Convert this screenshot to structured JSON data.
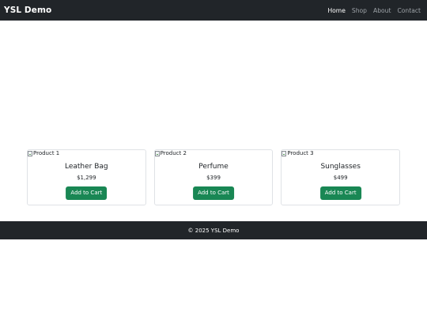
{
  "navbar": {
    "brand": "YSL Demo",
    "links": [
      {
        "label": "Home",
        "active": true
      },
      {
        "label": "Shop",
        "active": false
      },
      {
        "label": "About",
        "active": false
      },
      {
        "label": "Contact",
        "active": false
      }
    ]
  },
  "products": [
    {
      "image_alt": "Product 1",
      "name": "Leather Bag",
      "price": "$1,299",
      "button_label": "Add to Cart"
    },
    {
      "image_alt": "Product 2",
      "name": "Perfume",
      "price": "$399",
      "button_label": "Add to Cart"
    },
    {
      "image_alt": "Product 3",
      "name": "Sunglasses",
      "price": "$499",
      "button_label": "Add to Cart"
    }
  ],
  "footer": {
    "text": "© 2025 YSL Demo"
  },
  "colors": {
    "navbar_bg": "#212529",
    "button_bg": "#198754",
    "nav_active": "#ffffff",
    "nav_inactive": "#9ea3a8"
  },
  "icons": {
    "product_image": "broken-image-icon"
  }
}
